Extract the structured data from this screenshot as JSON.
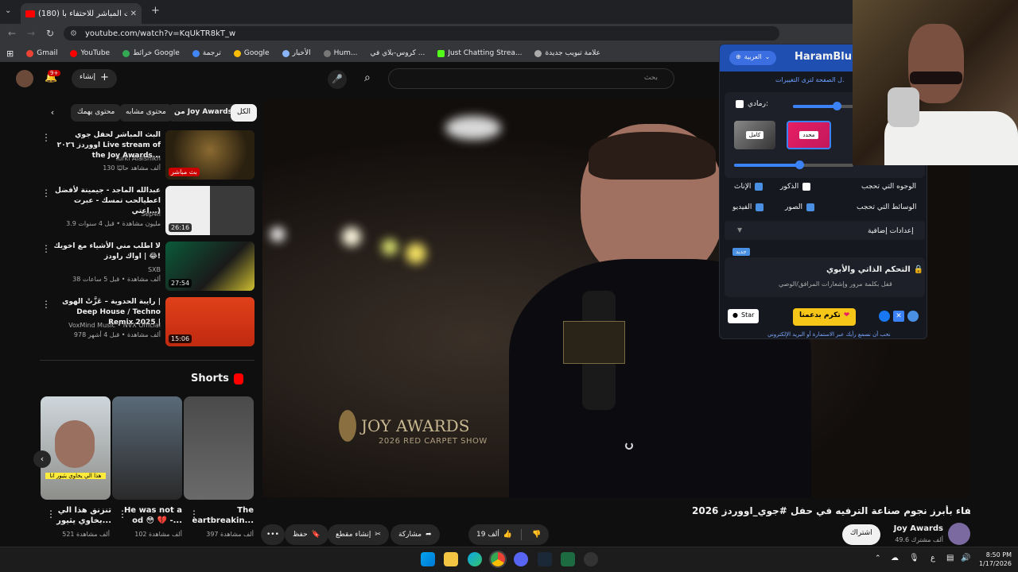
{
  "browser": {
    "tab_title": "(180) البث المباشر للاحتفاء بأ",
    "new_tab": "+",
    "url": "youtube.com/watch?v=KqUkTR8kT_w",
    "bookmarks": [
      "Gmail",
      "YouTube",
      "خرائط Google",
      "ترجمة",
      "Google",
      "الأخبار",
      "Hum...",
      "كروس-بلاي في ...",
      "Just Chatting Strea...",
      "علامة تبويب جديدة"
    ]
  },
  "youtube": {
    "create_label": "إنشاء",
    "notif_count": "9+",
    "search_placeholder": "بحث",
    "chips": [
      "الكل",
      "من Joy Awards",
      "محتوى مشابه",
      "محتوى يهمك"
    ],
    "related": [
      {
        "title": "البث المباشر لحفل جوي اووردز ٢٠٢٦ Live stream of the Joy Awards...",
        "channel": "Turki Alalshikh",
        "meta": "130 ألف مشاهد حاليًا",
        "badge": "بث مباشر"
      },
      {
        "title": "عبدالله الماجد - جيمينة لأفضل اعطيالحب تمسك - عبرت اعتي...)",
        "channel": "Sep4il",
        "meta": "3.9 مليون مشاهدة • قبل 4 سنوات",
        "badge": "26:16"
      },
      {
        "title": "لا اطلب مني الأشياء مع اخويك 😂 | اواك راودز!",
        "channel": "SXB",
        "meta": "38 ألف مشاهدة • قبل 5 ساعات",
        "badge": "27:54"
      },
      {
        "title": "رايبة الحدوية – عَزَّتْ الهوى | Deep House / Techno Remix 2025 |",
        "channel": "VoxMind Music • NVX Official",
        "meta": "978 ألف مشاهدة • قبل 4 أشهر",
        "badge": "15:06"
      }
    ],
    "shorts_label": "Shorts",
    "shorts": [
      {
        "caption": "تنزنق هذا الي بخاوي يثيور...",
        "meta": "521 ألف مشاهدة",
        "banner": "هذا الي يخاوي يثيور انا"
      },
      {
        "caption": "He was not a od 😳 💔 -...",
        "meta": "102 ألف مشاهدة"
      },
      {
        "caption": "The eartbreakin...",
        "meta": "397 ألف مشاهدة"
      }
    ],
    "video": {
      "title": "البث المباشر للاحتفاء بأبرز نجوم صناعة الترفيه في حفل #جوي_اووردز 2026",
      "hashtag": "#جوي_اووردز",
      "logo_main": "JOY AWARDS",
      "logo_sub": "2026 RED CARPET SHOW",
      "channel": "Joy Awards",
      "subs": "49.6 ألف مشترك",
      "subscribe": "اشتراك",
      "likes": "19 ألف",
      "share": "مشاركة",
      "clip": "إنشاء مقطع",
      "save": "حفظ",
      "more": "•••"
    }
  },
  "extension": {
    "lang": "العربية",
    "brand": "HaramBlur",
    "refresh_note": "ل الصفحة لترى التغييرات.",
    "grayscale_label": "رمادي:",
    "mode_full": "كامل",
    "mode_custom": "محدد",
    "faces_label": "الوجوه التي تحجب",
    "male": "الذكور",
    "female": "الإناث",
    "media_label": "الوسائط التي تحجب",
    "images": "الصور",
    "videos": "الفيديو",
    "more_settings": "إعدادات إضافية",
    "new_badge": "جديد",
    "parental_title": "التحكم الذاتي والأبوي",
    "parental_desc": "قفل بكلمة مرور وإشعارات المرافق/الوصي",
    "star": "Star",
    "donate": "تكرم بدعمنا",
    "footer": "نحب أن نسمع رأيك عبر الاستمارة أو البريد الإلكتروني",
    "colors": {
      "accent": "#1f4fb0",
      "pink": "#e91e63",
      "gold": "#f5c518"
    }
  },
  "taskbar": {
    "time": "8:50 PM",
    "date": "1/17/2026",
    "lang": "ع"
  }
}
